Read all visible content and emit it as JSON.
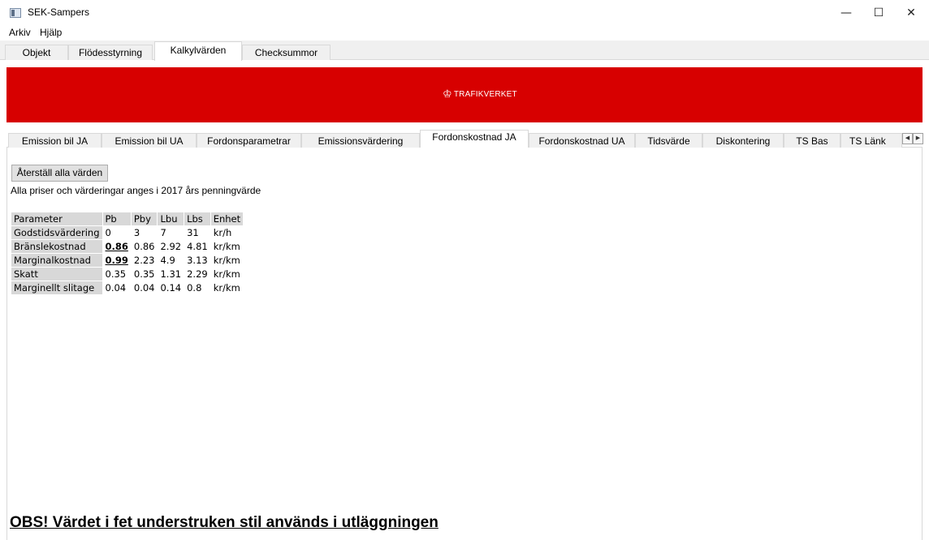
{
  "window": {
    "title": "SEK-Sampers",
    "minimize_glyph": "—",
    "maximize_glyph": "☐",
    "close_glyph": "✕"
  },
  "menu": [
    "Arkiv",
    "Hjälp"
  ],
  "main_tabs": [
    "Objekt",
    "Flödesstyrning",
    "Kalkylvärden",
    "Checksummor"
  ],
  "main_tab_active": "Kalkylvärden",
  "banner": {
    "logo_text": "TRAFIKVERKET",
    "crest_icon": "crown-crest-icon",
    "color": "#d70000"
  },
  "sub_tabs": [
    "Emission bil JA",
    "Emission bil UA",
    "Fordonsparametrar",
    "Emissionsvärdering",
    "Fordonskostnad JA",
    "Fordonskostnad UA",
    "Tidsvärde",
    "Diskontering",
    "TS Bas",
    "TS Länk"
  ],
  "sub_tab_active": "Fordonskostnad JA",
  "scroll": {
    "left": "◀",
    "right": "▶"
  },
  "content": {
    "reset_button": "Återställ alla värden",
    "note": "Alla priser och värderingar anges i 2017 års penningvärde",
    "table": {
      "headers": [
        "Parameter",
        "Pb",
        "Pby",
        "Lbu",
        "Lbs",
        "Enhet"
      ],
      "rows": [
        [
          "Godstidsvärdering",
          "0",
          "3",
          "7",
          "31",
          "kr/h"
        ],
        [
          "Bränslekostnad",
          "0.86",
          "0.86",
          "2.92",
          "4.81",
          "kr/km"
        ],
        [
          "Marginalkostnad",
          "0.99",
          "2.23",
          "4.9",
          "3.13",
          "kr/km"
        ],
        [
          "Skatt",
          "0.35",
          "0.35",
          "1.31",
          "2.29",
          "kr/km"
        ],
        [
          "Marginellt slitage",
          "0.04",
          "0.04",
          "0.14",
          "0.8",
          "kr/km"
        ]
      ]
    },
    "obs_text": "OBS! Värdet i fet understruken stil används i utläggningen"
  }
}
